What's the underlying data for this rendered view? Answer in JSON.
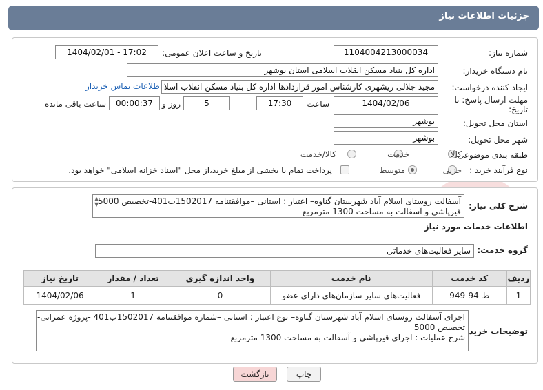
{
  "header": {
    "title": "جزئیات اطلاعات نیاز"
  },
  "form": {
    "need_number_label": "شماره نیاز:",
    "need_number": "1104004213000034",
    "announce_label": "تاریخ و ساعت اعلان عمومی:",
    "announce_value": "1404/02/01 - 17:02",
    "buyer_org_label": "نام دستگاه خریدار:",
    "buyer_org": "اداره کل بنیاد مسکن انقلاب اسلامی استان بوشهر",
    "requester_label": "ایجاد کننده درخواست:",
    "requester": "مجید جلالی ریشهری کارشناس امور قراردادها اداره کل بنیاد مسکن انقلاب اسلا",
    "contact_link": "اطلاعات تماس خریدار",
    "deadline_label_1": "مهلت ارسال پاسخ: تا",
    "deadline_label_2": "تاریخ:",
    "deadline_date": "1404/02/06",
    "time_label": "ساعت",
    "deadline_time": "17:30",
    "days_value": "5",
    "days_label": "روز و",
    "remaining_time": "00:00:37",
    "remaining_label": "ساعت باقی مانده",
    "province_label": "استان محل تحویل:",
    "province": "بوشهر",
    "city_label": "شهر محل تحویل:",
    "city": "بوشهر",
    "category_label": "طبقه بندی موضوعی:",
    "category_options": [
      "کالا",
      "خدمت",
      "کالا/خدمت"
    ],
    "process_label": "نوع فرآیند خرید :",
    "process_options": [
      "جزیی",
      "متوسط"
    ],
    "payment_note": "پرداخت تمام یا بخشی از مبلغ خرید،از محل \"اسناد خزانه اسلامی\" خواهد بود."
  },
  "summary": {
    "label": "شرح کلی نیاز:",
    "line1": "آسفالت روستای اسلام آباد  شهرستان گناوه– اعتبار : استانی –موافقتنامه 1502017ب401-تخصیص 5000",
    "line2": "قیرپاشی و آسفالت به مساحت 1300 مترمربع"
  },
  "services": {
    "section_title": "اطلاعات خدمات مورد نیاز",
    "group_label": "گروه خدمت:",
    "group_value": "سایر فعالیت‌های خدماتی",
    "columns": [
      "ردیف",
      "کد خدمت",
      "نام خدمت",
      "واحد اندازه گیری",
      "تعداد / مقدار",
      "تاریخ نیاز"
    ],
    "rows": [
      [
        "1",
        "ط-94-949",
        "فعالیت‌های سایر سازمان‌های دارای عضو",
        "0",
        "1",
        "1404/02/06"
      ]
    ]
  },
  "buyer_notes": {
    "label": "توضیحات خریدار:",
    "line1": "اجرای آسفالت روستای اسلام آباد  شهرستان گناوه– نوع اعتبار : استانی –شماره موافقتنامه 1502017ب401 -پروژه عمرانی-",
    "line2": "تخصیص 5000",
    "line3": "شرح عملیات : اجرای قیرپاشی و آسفالت به مساحت 1300 مترمربع"
  },
  "buttons": {
    "print": "چاپ",
    "back": "بازگشت"
  },
  "colors": {
    "header": "#6a7d97",
    "link": "#1a5fb4",
    "back_button": "#f7d6d6"
  },
  "watermark": {
    "icon": "ariatender-logo"
  }
}
